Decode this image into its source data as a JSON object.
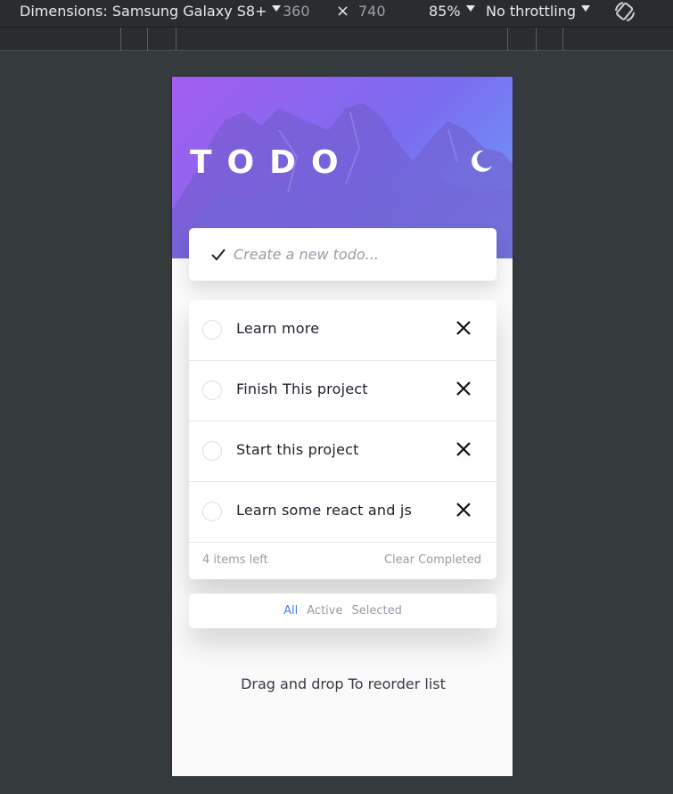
{
  "devtools": {
    "dimensions_label": "Dimensions: Samsung Galaxy S8+",
    "width": "360",
    "times": "×",
    "height": "740",
    "zoom": "85%",
    "throttling": "No throttling",
    "rotate_icon": "rotate-icon"
  },
  "app": {
    "title": "TODO",
    "theme_icon": "moon-icon",
    "new_todo": {
      "check_icon": "checkmark-icon",
      "placeholder": "Create a new todo..."
    },
    "todos": [
      {
        "text": "Learn more"
      },
      {
        "text": "Finish This project"
      },
      {
        "text": "Start this project"
      },
      {
        "text": "Learn some react and js"
      }
    ],
    "items_left": "4 items left",
    "clear_completed": "Clear Completed",
    "filters": {
      "all": "All",
      "active": "Active",
      "selected": "Selected"
    },
    "hint": "Drag and drop To reorder list"
  },
  "colors": {
    "accent": "#4a7ef0",
    "hero_start": "#a35ef0",
    "hero_end": "#6d9ff8"
  }
}
